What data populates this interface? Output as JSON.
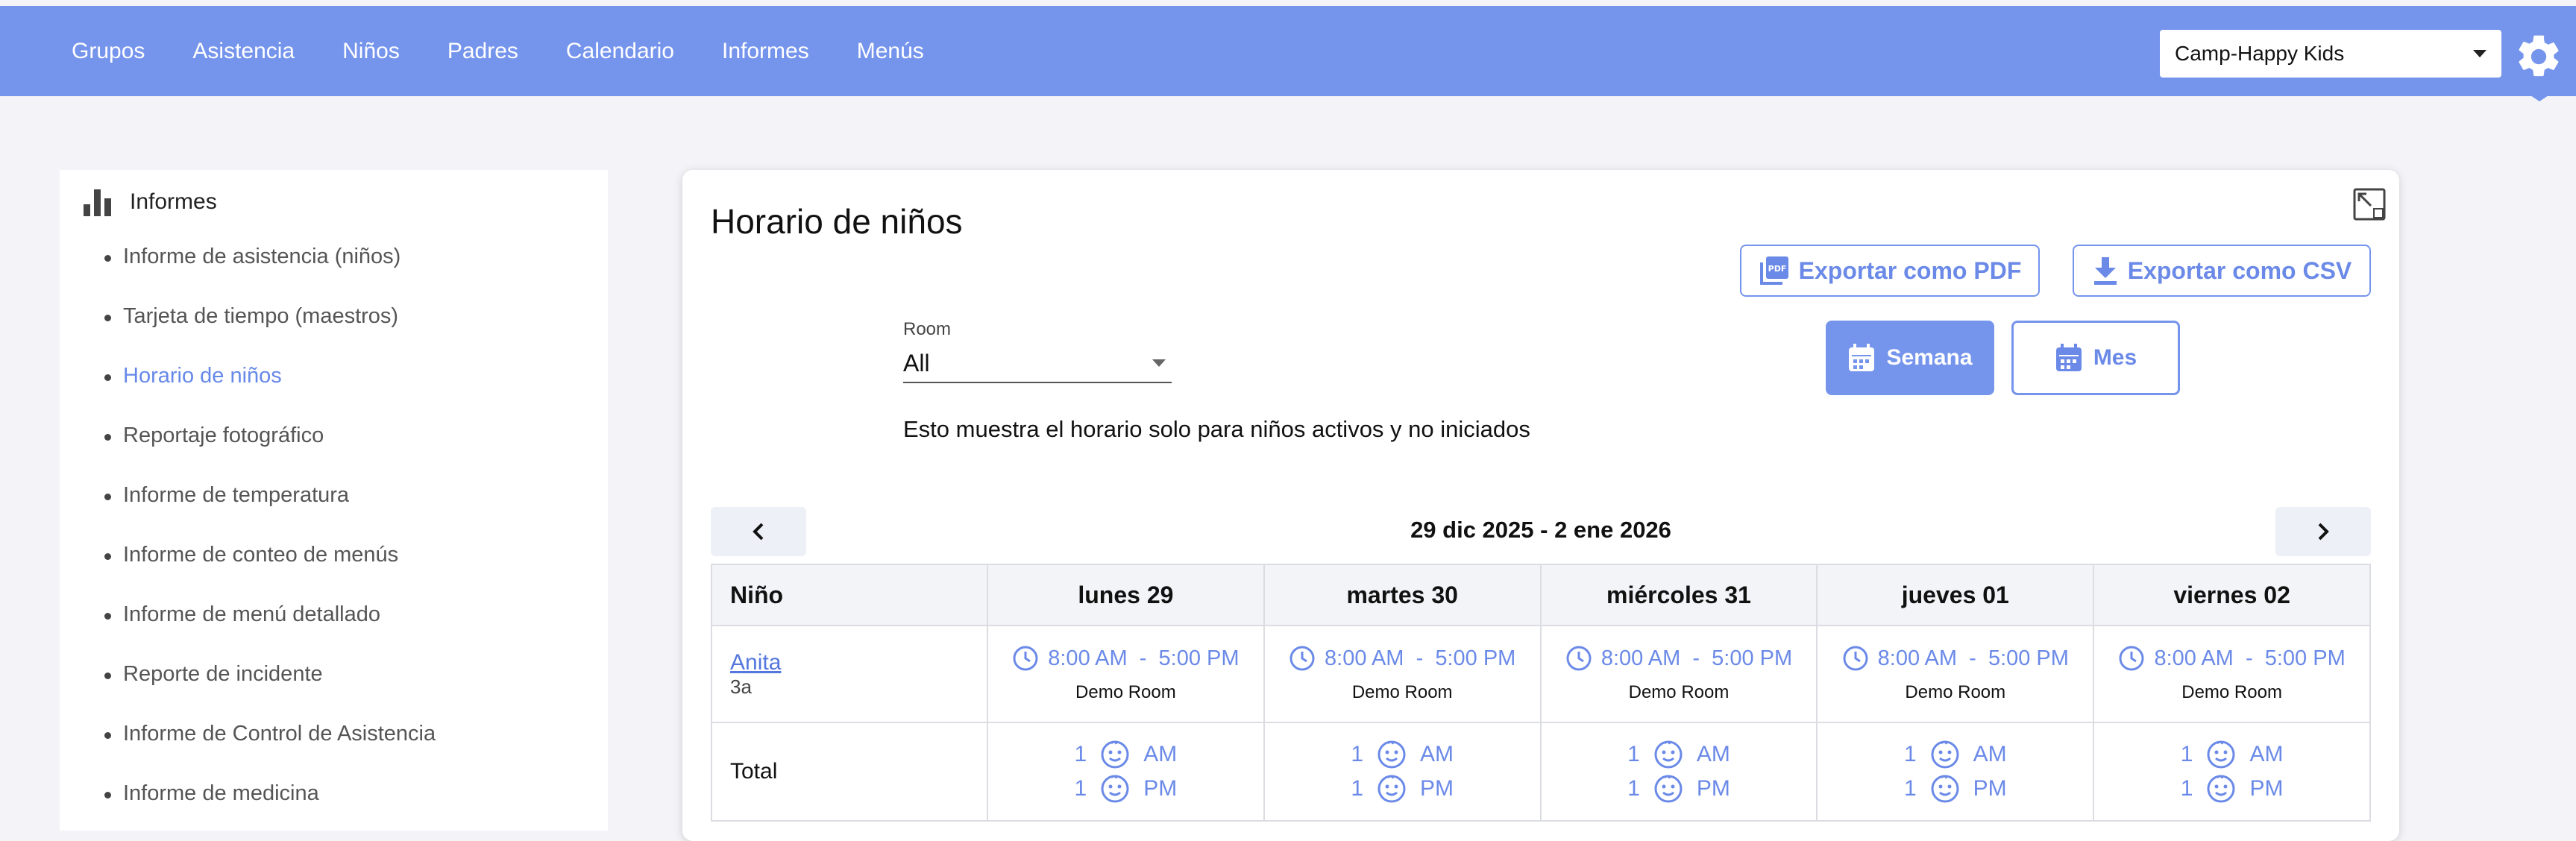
{
  "nav": {
    "items": [
      "Grupos",
      "Asistencia",
      "Niños",
      "Padres",
      "Calendario",
      "Informes",
      "Menús"
    ],
    "camp_selected": "Camp-Happy Kids"
  },
  "sidebar": {
    "heading": "Informes",
    "items": [
      {
        "label": "Informe de asistencia (niños)"
      },
      {
        "label": "Tarjeta de tiempo (maestros)"
      },
      {
        "label": "Horario de niños",
        "active": true
      },
      {
        "label": "Reportaje fotográfico"
      },
      {
        "label": "Informe de temperatura"
      },
      {
        "label": "Informe de conteo de menús"
      },
      {
        "label": "Informe de menú detallado"
      },
      {
        "label": "Reporte de incidente"
      },
      {
        "label": "Informe de Control de Asistencia"
      },
      {
        "label": "Informe de medicina"
      }
    ]
  },
  "main": {
    "title": "Horario de niños",
    "export_pdf": "Exportar como PDF",
    "export_csv": "Exportar como CSV",
    "view_week": "Semana",
    "view_month": "Mes",
    "room_label": "Room",
    "room_value": "All",
    "info": "Esto muestra el horario solo para niños activos y no iniciados",
    "week_range": "29 dic 2025 - 2 ene 2026"
  },
  "table": {
    "col_child": "Niño",
    "days": [
      "lunes 29",
      "martes 30",
      "miércoles 31",
      "jueves 01",
      "viernes 02"
    ],
    "children": [
      {
        "name": "Anita",
        "age": "3a",
        "schedule": [
          {
            "start": "8:00 AM",
            "end": "5:00 PM",
            "room": "Demo Room"
          },
          {
            "start": "8:00 AM",
            "end": "5:00 PM",
            "room": "Demo Room"
          },
          {
            "start": "8:00 AM",
            "end": "5:00 PM",
            "room": "Demo Room"
          },
          {
            "start": "8:00 AM",
            "end": "5:00 PM",
            "room": "Demo Room"
          },
          {
            "start": "8:00 AM",
            "end": "5:00 PM",
            "room": "Demo Room"
          }
        ]
      }
    ],
    "total_label": "Total",
    "totals": [
      {
        "am": "1",
        "pm": "1"
      },
      {
        "am": "1",
        "pm": "1"
      },
      {
        "am": "1",
        "pm": "1"
      },
      {
        "am": "1",
        "pm": "1"
      },
      {
        "am": "1",
        "pm": "1"
      }
    ],
    "am_label": "AM",
    "pm_label": "PM"
  },
  "colors": {
    "accent": "#7594ec",
    "link": "#6b8ae8"
  }
}
